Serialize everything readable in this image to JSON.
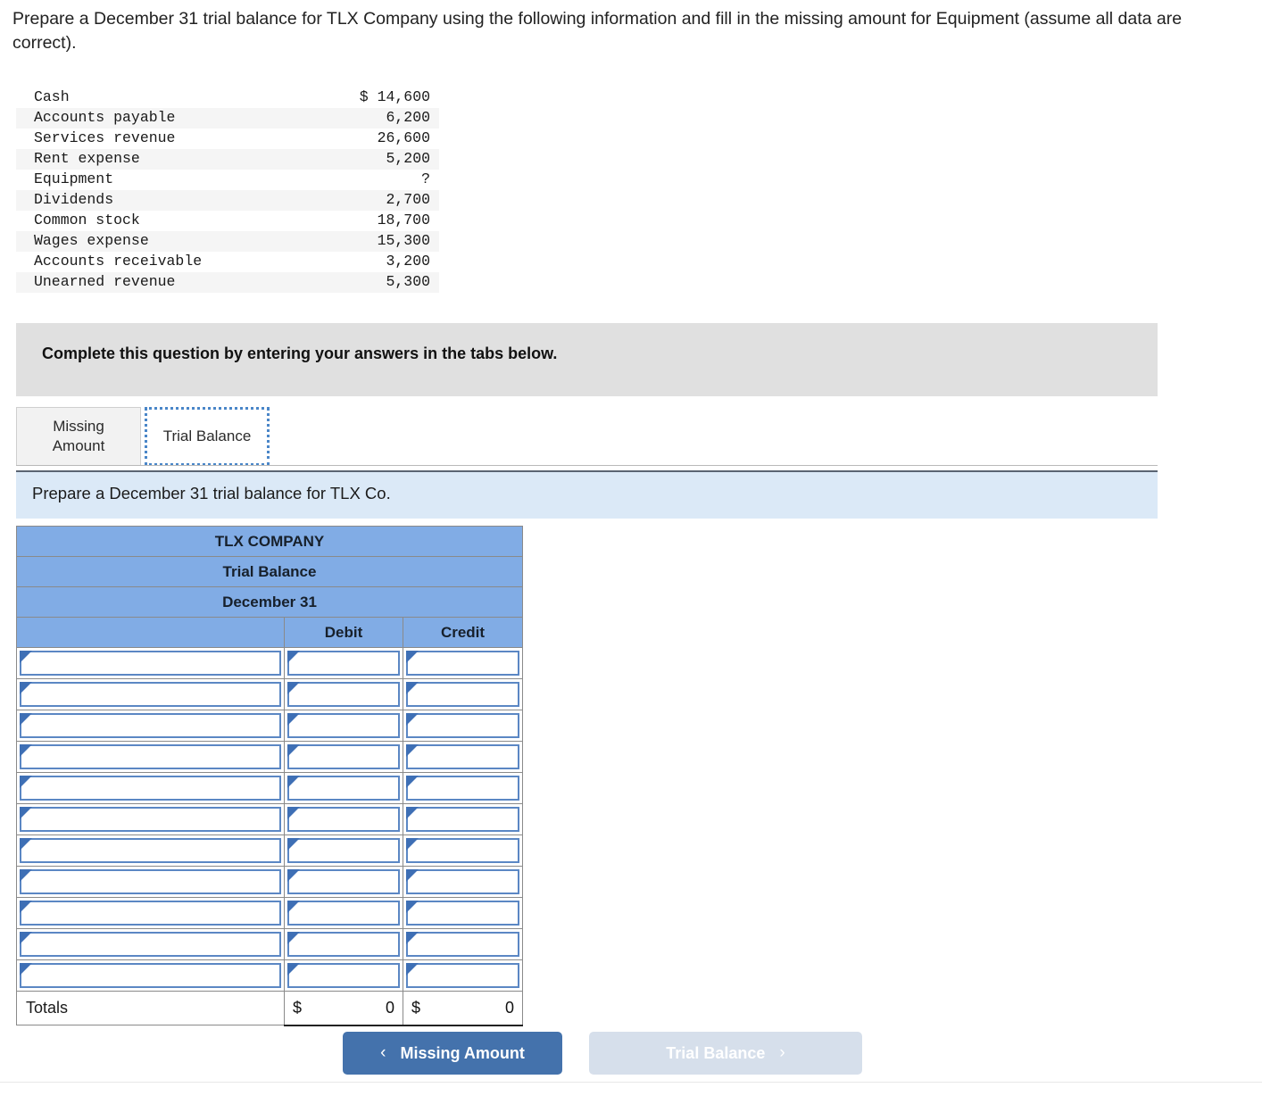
{
  "prompt": "Prepare a December 31 trial balance for TLX Company using the following information and fill in the missing amount for Equipment (assume all data are correct).",
  "given_data": {
    "rows": [
      {
        "account": "Cash",
        "amount": "$ 14,600"
      },
      {
        "account": "Accounts payable",
        "amount": "6,200"
      },
      {
        "account": "Services revenue",
        "amount": "26,600"
      },
      {
        "account": "Rent expense",
        "amount": "5,200"
      },
      {
        "account": "Equipment",
        "amount": "?"
      },
      {
        "account": "Dividends",
        "amount": "2,700"
      },
      {
        "account": "Common stock",
        "amount": "18,700"
      },
      {
        "account": "Wages expense",
        "amount": "15,300"
      },
      {
        "account": "Accounts receivable",
        "amount": "3,200"
      },
      {
        "account": "Unearned revenue",
        "amount": "5,300"
      }
    ]
  },
  "instruction_banner": {
    "text": "Complete this question by entering your answers in the tabs below."
  },
  "tabs": [
    {
      "label": "Missing\nAmount",
      "active": false
    },
    {
      "label": "Trial Balance",
      "active": true
    }
  ],
  "tab_labels": {
    "missing_amount": "Missing Amount",
    "trial_balance": "Trial Balance"
  },
  "sub_instruction": {
    "text": "Prepare a December 31 trial balance for TLX Co."
  },
  "worksheet": {
    "title_line1": "TLX COMPANY",
    "title_line2": "Trial Balance",
    "title_line3": "December 31",
    "col_account": "",
    "col_debit": "Debit",
    "col_credit": "Credit",
    "entry_row_count": 11,
    "totals_label": "Totals",
    "totals_debit_symbol": "$",
    "totals_debit_value": "0",
    "totals_credit_symbol": "$",
    "totals_credit_value": "0"
  },
  "footer_nav": {
    "prev_label": "Missing Amount",
    "prev_chevron": "‹",
    "next_label": "Trial Balance",
    "next_chevron": "›"
  },
  "colors": {
    "header_blue": "#81ace5",
    "cell_border_blue": "#5b87c4",
    "primary_button": "#4472ac",
    "disabled_button": "#d6dfeb",
    "grey_banner": "#e0e0e0",
    "blue_banner": "#dbe9f7"
  }
}
